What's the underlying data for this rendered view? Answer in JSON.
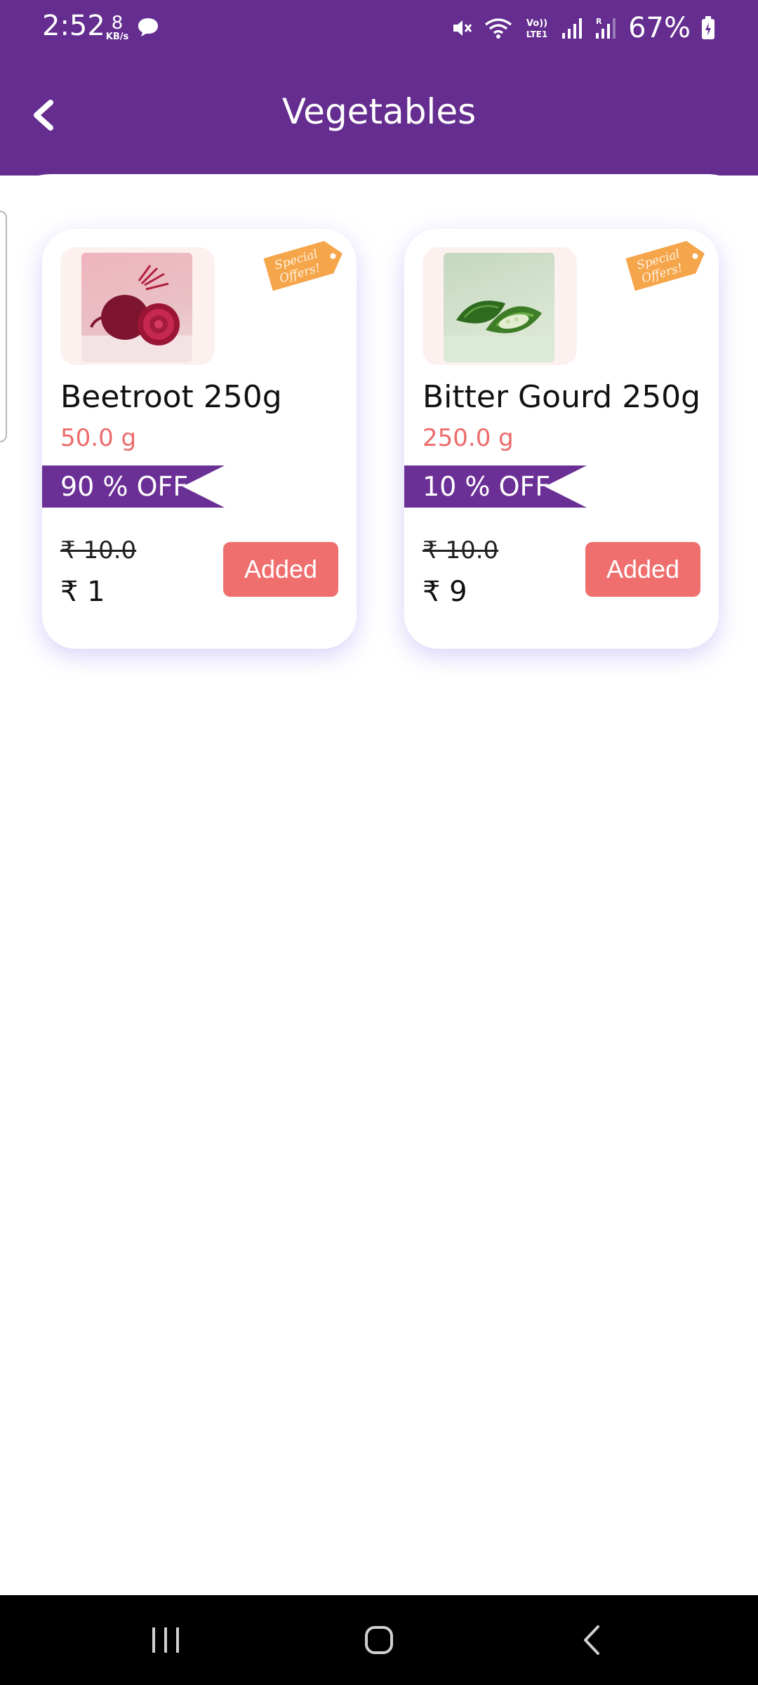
{
  "status_bar": {
    "time": "2:52",
    "speed_value": "8",
    "speed_unit": "KB/s",
    "battery": "67%",
    "icons": [
      "chat-icon",
      "mute-icon",
      "wifi-icon",
      "volte-icon",
      "signal-icon",
      "signal-icon",
      "battery-icon"
    ]
  },
  "header": {
    "title": "Vegetables",
    "background": "#642d8f"
  },
  "products": [
    {
      "name": "Beetroot 250g",
      "weight": "50.0 g",
      "discount": "90 % OFF",
      "mrp": "₹ 10.0",
      "price": "₹ 1",
      "button": "Added",
      "tag_line1": "Special",
      "tag_line2": "Offers!"
    },
    {
      "name": "Bitter Gourd 250g",
      "weight": "250.0 g",
      "discount": "10 % OFF",
      "mrp": "₹ 10.0",
      "price": "₹ 9",
      "button": "Added",
      "tag_line1": "Special",
      "tag_line2": "Offers!"
    }
  ],
  "colors": {
    "accent": "#642d8f",
    "ribbon": "#6b3096",
    "button": "#ef6f6f",
    "weight_text": "#ec6a6a",
    "tag": "#f5a54a"
  }
}
